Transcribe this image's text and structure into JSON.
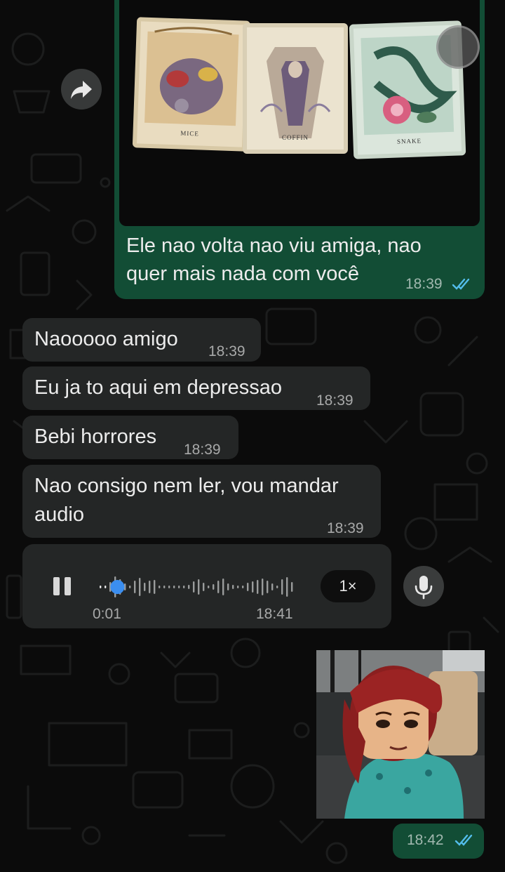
{
  "messages": [
    {
      "text_line1": "Ele nao volta nao viu amiga, nao",
      "text_line2": "quer mais nada com você",
      "time": "18:39",
      "status": "read"
    },
    {
      "text": "Naooooo amigo",
      "time": "18:39"
    },
    {
      "text": "Eu ja to aqui em depressao",
      "time": "18:39"
    },
    {
      "text": "Bebi horrores",
      "time": "18:39"
    },
    {
      "text_line1": "Nao consigo nem ler, vou mandar",
      "text_line2": "audio",
      "time": "18:39"
    }
  ],
  "tarot_cards": [
    "MICE",
    "COFFIN",
    "SNAKE"
  ],
  "audio": {
    "elapsed": "0:01",
    "time": "18:41",
    "speed": "1×",
    "progress": 0.06
  },
  "gif_message": {
    "time": "18:42",
    "status": "read"
  },
  "colors": {
    "incoming_bubble": "#242626",
    "outgoing_bubble": "#124d35",
    "read_ticks": "#53bdeb",
    "playhead": "#3b8ef0"
  },
  "icons": {
    "forward": "forward-arrow-icon",
    "pause": "pause-icon",
    "mic": "microphone-icon",
    "read": "double-check-icon"
  }
}
